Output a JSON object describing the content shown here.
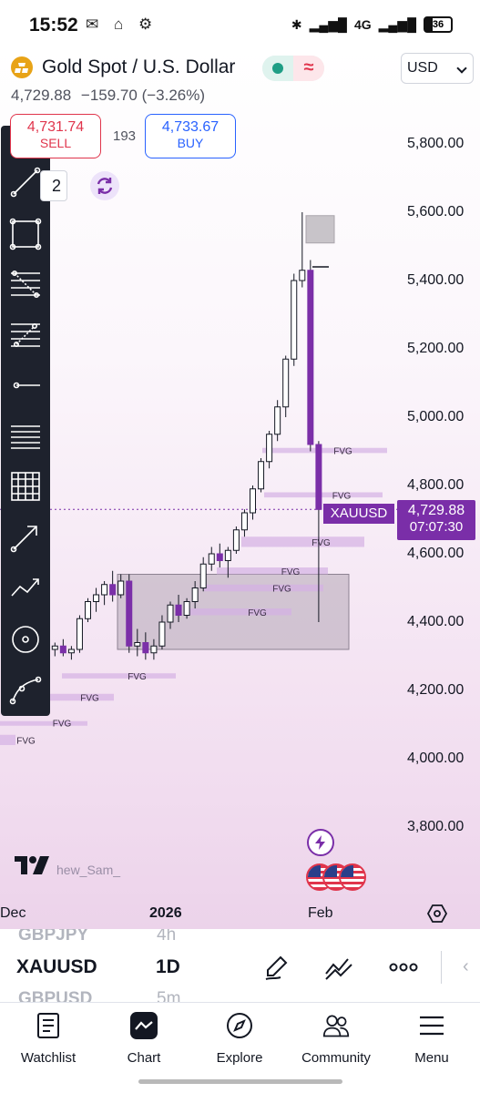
{
  "status_bar": {
    "time": "15:52",
    "network": "4G",
    "battery": "36"
  },
  "symbol": {
    "title": "Gold Spot / U.S. Dollar",
    "currency": "USD",
    "last": "4,729.88",
    "change": "−159.70 (−3.26%)"
  },
  "trade": {
    "sell_price": "4,731.74",
    "sell_label": "SELL",
    "spread": "193",
    "buy_price": "4,733.67",
    "buy_label": "BUY",
    "partial_value": "2"
  },
  "chart": {
    "price_ticks": [
      "5,800.00",
      "5,600.00",
      "5,400.00",
      "5,200.00",
      "5,000.00",
      "4,800.00",
      "4,600.00",
      "4,400.00",
      "4,200.00",
      "4,000.00",
      "3,800.00"
    ],
    "date_ticks": [
      "Dec",
      "2026",
      "Feb"
    ],
    "last_symbol_tag": "XAUUSD",
    "last_price_tag": "4,729.88",
    "countdown": "07:07:30",
    "fvg_label": "FVG",
    "author": "hew_Sam_",
    "colors": {
      "bull": "#ffffff",
      "bear": "#7b2fa8",
      "fvg": "#d4b0e4",
      "accent": "#7a2ea8"
    }
  },
  "chart_data": {
    "type": "candlestick",
    "symbol": "XAUUSD",
    "x_labels": [
      "Dec",
      "2026",
      "Feb"
    ],
    "ylim": [
      3800,
      5800
    ],
    "last_price": 4729.88,
    "candles": [
      [
        4200,
        4240,
        4190,
        4230
      ],
      [
        4230,
        4260,
        4210,
        4250
      ],
      [
        4250,
        4280,
        4230,
        4270
      ],
      [
        4270,
        4300,
        4250,
        4290
      ],
      [
        4290,
        4310,
        4270,
        4300
      ],
      [
        4300,
        4330,
        4280,
        4320
      ],
      [
        4320,
        4340,
        4300,
        4330
      ],
      [
        4330,
        4350,
        4300,
        4310
      ],
      [
        4310,
        4330,
        4290,
        4320
      ],
      [
        4320,
        4420,
        4310,
        4410
      ],
      [
        4410,
        4470,
        4400,
        4460
      ],
      [
        4460,
        4500,
        4430,
        4480
      ],
      [
        4480,
        4520,
        4450,
        4510
      ],
      [
        4510,
        4550,
        4460,
        4480
      ],
      [
        4480,
        4540,
        4470,
        4520
      ],
      [
        4520,
        4540,
        4310,
        4330
      ],
      [
        4330,
        4380,
        4300,
        4340
      ],
      [
        4340,
        4370,
        4290,
        4310
      ],
      [
        4310,
        4350,
        4290,
        4330
      ],
      [
        4330,
        4420,
        4320,
        4400
      ],
      [
        4400,
        4460,
        4380,
        4450
      ],
      [
        4450,
        4480,
        4400,
        4420
      ],
      [
        4420,
        4470,
        4410,
        4460
      ],
      [
        4460,
        4520,
        4440,
        4500
      ],
      [
        4500,
        4590,
        4490,
        4570
      ],
      [
        4570,
        4620,
        4550,
        4600
      ],
      [
        4600,
        4630,
        4560,
        4580
      ],
      [
        4580,
        4620,
        4530,
        4610
      ],
      [
        4610,
        4680,
        4600,
        4670
      ],
      [
        4670,
        4730,
        4650,
        4720
      ],
      [
        4720,
        4800,
        4700,
        4790
      ],
      [
        4790,
        4880,
        4780,
        4870
      ],
      [
        4870,
        4960,
        4850,
        4950
      ],
      [
        4950,
        5050,
        4930,
        5030
      ],
      [
        5030,
        5180,
        5000,
        5170
      ],
      [
        5170,
        5420,
        5150,
        5400
      ],
      [
        5400,
        5600,
        5380,
        5430
      ],
      [
        5430,
        5460,
        4900,
        4920
      ],
      [
        4920,
        4930,
        4400,
        4729.88
      ]
    ],
    "fvg_zones": [
      {
        "label": "FVG",
        "top": 4910,
        "bottom": 4895
      },
      {
        "label": "FVG",
        "top": 4780,
        "bottom": 4765
      },
      {
        "label": "FVG",
        "top": 4650,
        "bottom": 4620
      },
      {
        "label": "FVG",
        "top": 4560,
        "bottom": 4540
      },
      {
        "label": "FVG",
        "top": 4510,
        "bottom": 4490
      },
      {
        "label": "FVG",
        "top": 4440,
        "bottom": 4420
      },
      {
        "label": "FVG",
        "top": 4250,
        "bottom": 4235
      },
      {
        "label": "FVG",
        "top": 4190,
        "bottom": 4170
      },
      {
        "label": "FVG",
        "top": 4110,
        "bottom": 4100
      },
      {
        "label": "FVG",
        "top": 4070,
        "bottom": 4040
      }
    ],
    "consolidation_box": {
      "top": 4540,
      "bottom": 4320
    }
  },
  "toolbar_icons": [
    "trend-line-icon",
    "rectangle-icon",
    "fib-retracement-icon",
    "fib-extension-icon",
    "horizontal-ray-icon",
    "horizontal-lines-icon",
    "grid-icon",
    "arrow-icon",
    "path-icon",
    "circle-target-icon",
    "curve-icon"
  ],
  "watchlist_bar": {
    "prev_symbol": "GBPJPY",
    "prev_tf": "4h",
    "symbol": "XAUUSD",
    "timeframe": "1D",
    "next_symbol": "GBPUSD",
    "next_tf": "5m"
  },
  "nav": [
    {
      "label": "Watchlist"
    },
    {
      "label": "Chart"
    },
    {
      "label": "Explore"
    },
    {
      "label": "Community"
    },
    {
      "label": "Menu"
    }
  ]
}
